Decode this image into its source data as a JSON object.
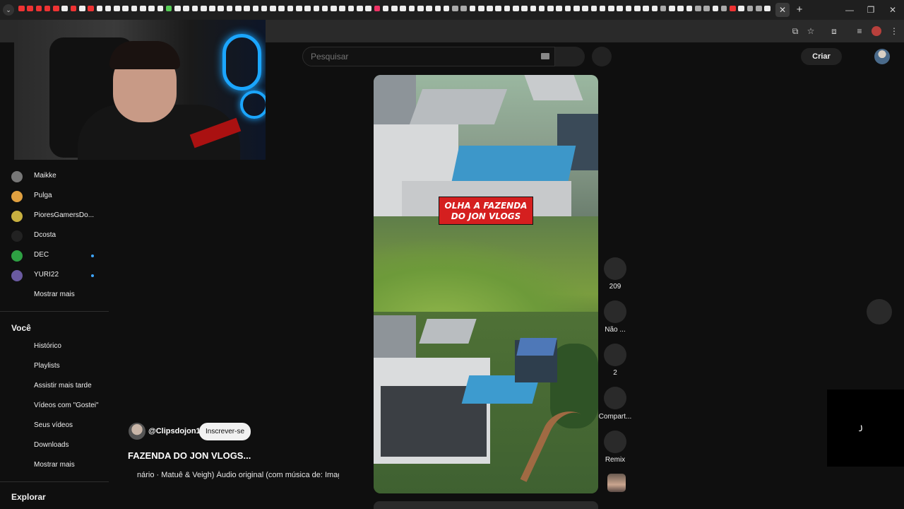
{
  "browser": {
    "tab_close": "✕",
    "new_tab": "+",
    "tab_favicons": [
      "#e33",
      "#e33",
      "#e33",
      "#e33",
      "#e33",
      "#eee",
      "#e33",
      "#eee",
      "#e33",
      "#eee",
      "#eee",
      "#eee",
      "#eee",
      "#eee",
      "#eee",
      "#eee",
      "#eee",
      "#5c5",
      "#eee",
      "#eee",
      "#eee",
      "#eee",
      "#eee",
      "#eee",
      "#eee",
      "#eee",
      "#eee",
      "#eee",
      "#eee",
      "#eee",
      "#eee",
      "#eee",
      "#eee",
      "#eee",
      "#eee",
      "#eee",
      "#eee",
      "#eee",
      "#eee",
      "#eee",
      "#eee",
      "#e36",
      "#eee",
      "#eee",
      "#eee",
      "#eee",
      "#eee",
      "#eee",
      "#eee",
      "#eee",
      "#aaa",
      "#aaa",
      "#eee",
      "#eee",
      "#eee",
      "#eee",
      "#eee",
      "#eee",
      "#eee",
      "#eee",
      "#eee",
      "#eee",
      "#eee",
      "#eee",
      "#eee",
      "#eee",
      "#eee",
      "#eee",
      "#eee",
      "#eee",
      "#eee",
      "#eee",
      "#eee",
      "#eee",
      "#aaa",
      "#eee",
      "#eee",
      "#eee",
      "#aaa",
      "#aaa",
      "#eee",
      "#aaa",
      "#e33",
      "#eee",
      "#aaa",
      "#aaa",
      "#eee",
      "#e33"
    ]
  },
  "header": {
    "search_placeholder": "Pesquisar",
    "create_label": "Criar"
  },
  "sidebar": {
    "subscriptions": [
      {
        "name": "Maikke",
        "color": "#777",
        "new": false
      },
      {
        "name": "Pulga",
        "color": "#e0a040",
        "new": false
      },
      {
        "name": "PioresGamersDo...",
        "color": "#c8b040",
        "new": false
      },
      {
        "name": "Dcosta",
        "color": "#222",
        "new": false
      },
      {
        "name": "DEC",
        "color": "#2ea043",
        "new": true
      },
      {
        "name": "YURI22",
        "color": "#6a5aa0",
        "new": true
      }
    ],
    "show_more": "Mostrar mais",
    "you_heading": "Você",
    "you_items": [
      "Histórico",
      "Playlists",
      "Assistir mais tarde",
      "Vídeos com \"Gostei\"",
      "Seus vídeos",
      "Downloads",
      "Mostrar mais"
    ],
    "explore_heading": "Explorar"
  },
  "short": {
    "overlay_line1": "OLHA A FAZENDA",
    "overlay_line2": "DO JON VLOGS",
    "channel": "@Clipsdojon1",
    "subscribe_label": "Inscrever-se",
    "title": "FAZENDA DO JON VLOGS...",
    "music": "nário · Matuê & Veigh)    Áudio original (com música de: Imag"
  },
  "actions": {
    "like_count": "209",
    "dislike_label": "Não ...",
    "comments_count": "2",
    "share_label": "Compart...",
    "remix_label": "Remix"
  }
}
